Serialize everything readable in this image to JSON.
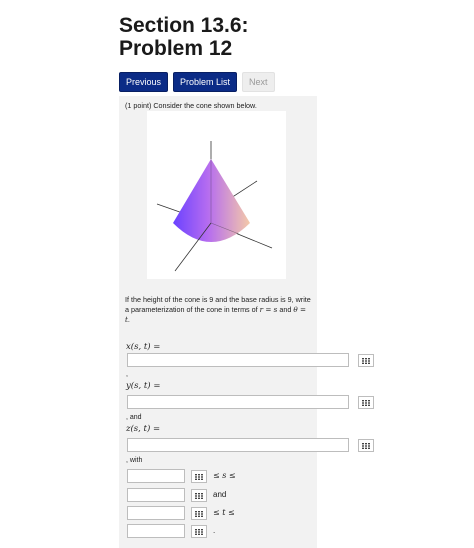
{
  "header": {
    "title_line1": "Section 13.6:",
    "title_line2": "Problem 12"
  },
  "nav": {
    "previous": "Previous",
    "problem_list": "Problem List",
    "next": "Next"
  },
  "problem": {
    "prompt": "(1 point) Consider the cone shown below.",
    "question_text": "If the height of the cone is 9 and the base radius is 9, write a parameterization of the cone in terms of",
    "r_eq_s": "r = s",
    "and": "and",
    "theta_eq_t": "θ = t",
    "period": "."
  },
  "answers": {
    "x_label": "x(s, t) =",
    "y_label": "y(s, t) =",
    "z_label": "z(s, t) =",
    "comma1": ",",
    "comma_and": ", and",
    "comma_with": ", with",
    "s_rel": "≤ s ≤",
    "and_text": "and",
    "t_rel": "≤ t ≤",
    "end_period": "."
  },
  "icons": {
    "keyboard": "keypad-icon"
  }
}
